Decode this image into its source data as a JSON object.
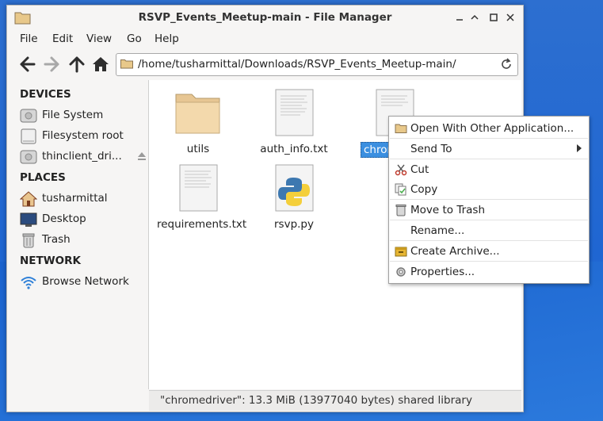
{
  "window": {
    "title": "RSVP_Events_Meetup-main - File Manager",
    "minimize_glyph": "✕",
    "maximize_glyph": "□",
    "close_glyph": "✕",
    "min_glyph": "▁"
  },
  "menubar": {
    "items": [
      "File",
      "Edit",
      "View",
      "Go",
      "Help"
    ]
  },
  "toolbar": {
    "path": "/home/tusharmittal/Downloads/RSVP_Events_Meetup-main/"
  },
  "sidebar": {
    "sections": [
      {
        "heading": "DEVICES",
        "items": [
          "File System",
          "Filesystem root",
          "thinclient_dri..."
        ]
      },
      {
        "heading": "PLACES",
        "items": [
          "tusharmittal",
          "Desktop",
          "Trash"
        ]
      },
      {
        "heading": "NETWORK",
        "items": [
          "Browse Network"
        ]
      }
    ]
  },
  "files": [
    {
      "name": "utils",
      "icon": "folder-icon"
    },
    {
      "name": "auth_info.txt",
      "icon": "text-file-icon"
    },
    {
      "name": "chrom",
      "icon": "binary-file-icon",
      "selected": true
    },
    {
      "name": "requirements.txt",
      "icon": "text-file-icon"
    },
    {
      "name": "rsvp.py",
      "icon": "python-file-icon"
    }
  ],
  "context_menu": {
    "items": [
      {
        "label": "Open With Other Application...",
        "icon": "folder-icon"
      },
      {
        "label": "Send To",
        "icon": "",
        "submenu": true
      },
      {
        "label": "Cut",
        "icon": "scissors-icon"
      },
      {
        "label": "Copy",
        "icon": "copy-icon"
      },
      {
        "label": "Move to Trash",
        "icon": "trash-icon"
      },
      {
        "label": "Rename...",
        "icon": ""
      },
      {
        "label": "Create Archive...",
        "icon": "archive-icon"
      },
      {
        "label": "Properties...",
        "icon": "gear-icon"
      }
    ]
  },
  "status": {
    "text": "\"chromedriver\": 13.3 MiB (13977040 bytes) shared library"
  },
  "colors": {
    "selection": "#3b8fe0",
    "desktop": "#1f66d2"
  }
}
